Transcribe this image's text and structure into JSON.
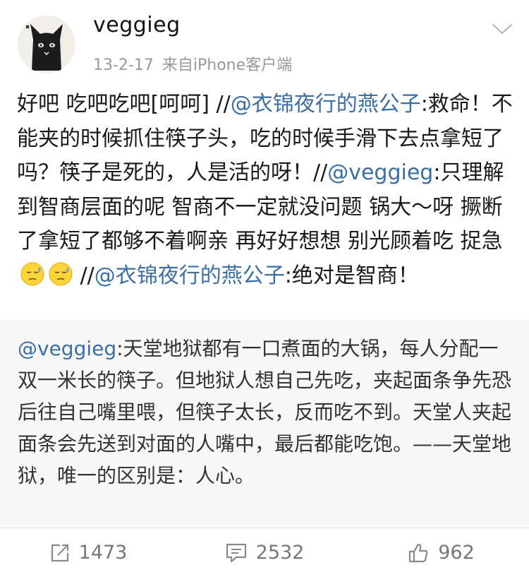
{
  "user": {
    "name": "veggieg",
    "date": "13-2-17",
    "source": "来自iPhone客户端"
  },
  "post": {
    "seg1": "好吧 吃吧吃吧[呵呵] //",
    "mention1": "@衣锦夜行的燕公子",
    "seg2": ":救命！不能夹的时候抓住筷子头，吃的时候手滑下去点拿短了吗？筷子是死的，人是活的呀！//",
    "mention2": "@veggieg",
    "seg3": ":只理解到智商层面的呢 智商不一定就没问题 锅大～呀 撅断了拿短了都够不着啊亲 再好好想想 别光顾着吃 捉急",
    "seg4": " //",
    "mention3": "@衣锦夜行的燕公子",
    "seg5": ":绝对是智商！"
  },
  "repost": {
    "mention": "@veggieg",
    "text": ":天堂地狱都有一口煮面的大锅，每人分配一双一米长的筷子。但地狱人想自己先吃，夹起面条争先恐后往自己嘴里喂，但筷子太长，反而吃不到。天堂人夹起面条会先送到对面的人嘴中，最后都能吃饱。——天堂地狱，唯一的区别是：人心。"
  },
  "actions": {
    "repost_count": "1473",
    "comment_count": "2532",
    "like_count": "962"
  },
  "icons": {
    "avatar": "black-cat-avatar",
    "menu": "chevron-down-icon",
    "emoji": "sweat-face-emoji",
    "repost": "repost-icon",
    "comment": "comment-icon",
    "like": "thumbs-up-icon"
  },
  "colors": {
    "mention": "#3a6ea5",
    "repost_bg": "#f7f7f7",
    "meta_text": "#999999"
  }
}
